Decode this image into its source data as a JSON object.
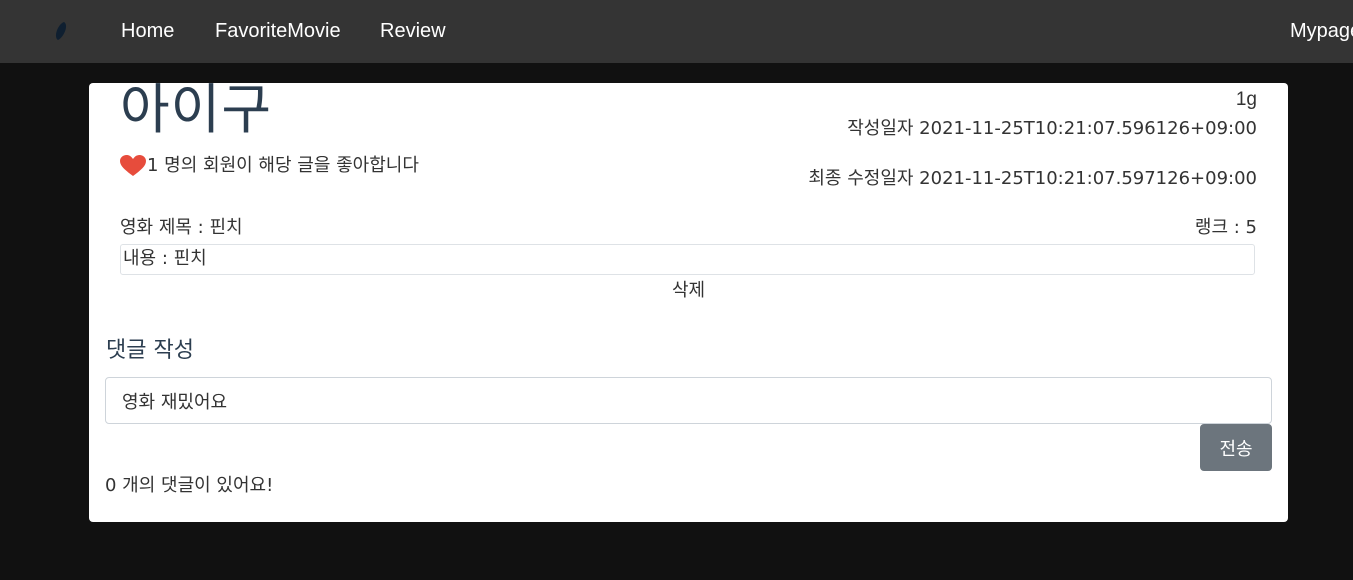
{
  "nav": {
    "logo_icon": "leaf-icon",
    "home": "Home",
    "favorite": "FavoriteMovie",
    "review": "Review",
    "mypage": "Mypage"
  },
  "post": {
    "title": "아이구",
    "weight": "1g",
    "created": "작성일자 2021-11-25T10:21:07.596126+09:00",
    "updated": "최종 수정일자 2021-11-25T10:21:07.597126+09:00",
    "likes_text": "1 명의 회원이 해당 글을 좋아합니다",
    "like_icon": "heart-icon",
    "movie_title": "영화 제목 : 핀치",
    "rank": "랭크 : 5",
    "content": "내용 : 핀치",
    "delete_label": "삭제"
  },
  "comments": {
    "heading": "댓글 작성",
    "input_value": "영화 재밌어요",
    "submit_label": "전송",
    "count_text": "0 개의 댓글이 있어요!"
  },
  "colors": {
    "navbar": "#343434",
    "background": "#111111",
    "heart": "#e74c3c",
    "button": "#6c757d"
  }
}
